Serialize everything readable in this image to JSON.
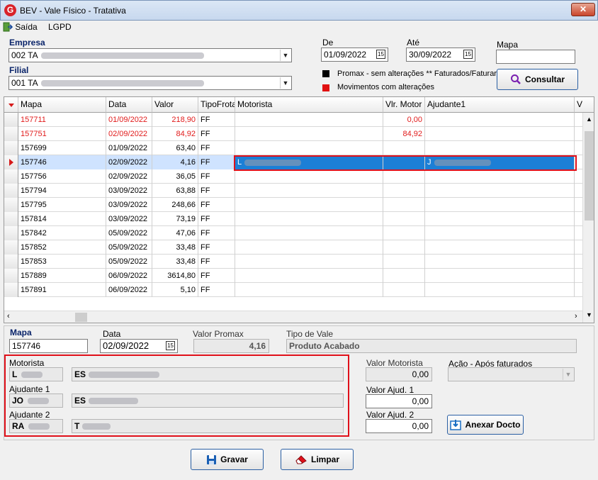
{
  "window": {
    "title": "BEV - Vale Físico - Tratativa",
    "app_icon": "G",
    "close_icon": "✕"
  },
  "menu": {
    "saida": "Saída",
    "lgpd": "LGPD"
  },
  "filters": {
    "empresa_label": "Empresa",
    "empresa_value": "002 TA",
    "filial_label": "Filial",
    "filial_value": "001 TA",
    "de_label": "De",
    "de_value": "01/09/2022",
    "ate_label": "Até",
    "ate_value": "30/09/2022",
    "mapa_label": "Mapa",
    "mapa_value": "",
    "calendar_glyph": "15"
  },
  "legend": [
    {
      "text": "Promax - sem alterações ** Faturados/Faturar",
      "color": "#000000"
    },
    {
      "text": "Movimentos com alterações",
      "color": "#e01010"
    }
  ],
  "consultar_label": "Consultar",
  "grid": {
    "headers": [
      "Mapa",
      "Data",
      "Valor",
      "TipoFrota",
      "Motorista",
      "Vlr. Motor",
      "Ajudante1",
      "V"
    ],
    "rows": [
      {
        "mapa": "157711",
        "data": "01/09/2022",
        "valor": "218,90",
        "tipo": "FF",
        "motorista": "",
        "vlr_motor": "0,00",
        "ajudante1": "",
        "red": true
      },
      {
        "mapa": "157751",
        "data": "02/09/2022",
        "valor": "84,92",
        "tipo": "FF",
        "motorista": "",
        "vlr_motor": "84,92",
        "ajudante1": "",
        "red": true
      },
      {
        "mapa": "157699",
        "data": "01/09/2022",
        "valor": "63,40",
        "tipo": "FF",
        "motorista": "",
        "vlr_motor": "",
        "ajudante1": ""
      },
      {
        "mapa": "157746",
        "data": "02/09/2022",
        "valor": "4,16",
        "tipo": "FF",
        "motorista": "L",
        "vlr_motor": "",
        "ajudante1": "J",
        "selected": true
      },
      {
        "mapa": "157756",
        "data": "02/09/2022",
        "valor": "36,05",
        "tipo": "FF",
        "motorista": "",
        "vlr_motor": "",
        "ajudante1": ""
      },
      {
        "mapa": "157794",
        "data": "03/09/2022",
        "valor": "63,88",
        "tipo": "FF",
        "motorista": "",
        "vlr_motor": "",
        "ajudante1": ""
      },
      {
        "mapa": "157795",
        "data": "03/09/2022",
        "valor": "248,66",
        "tipo": "FF",
        "motorista": "",
        "vlr_motor": "",
        "ajudante1": ""
      },
      {
        "mapa": "157814",
        "data": "03/09/2022",
        "valor": "73,19",
        "tipo": "FF",
        "motorista": "",
        "vlr_motor": "",
        "ajudante1": ""
      },
      {
        "mapa": "157842",
        "data": "05/09/2022",
        "valor": "47,06",
        "tipo": "FF",
        "motorista": "",
        "vlr_motor": "",
        "ajudante1": ""
      },
      {
        "mapa": "157852",
        "data": "05/09/2022",
        "valor": "33,48",
        "tipo": "FF",
        "motorista": "",
        "vlr_motor": "",
        "ajudante1": ""
      },
      {
        "mapa": "157853",
        "data": "05/09/2022",
        "valor": "33,48",
        "tipo": "FF",
        "motorista": "",
        "vlr_motor": "",
        "ajudante1": ""
      },
      {
        "mapa": "157889",
        "data": "06/09/2022",
        "valor": "3614,80",
        "tipo": "FF",
        "motorista": "",
        "vlr_motor": "",
        "ajudante1": ""
      },
      {
        "mapa": "157891",
        "data": "06/09/2022",
        "valor": "5,10",
        "tipo": "FF",
        "motorista": "",
        "vlr_motor": "",
        "ajudante1": ""
      }
    ]
  },
  "detail": {
    "mapa_label": "Mapa",
    "mapa_value": "157746",
    "data_label": "Data",
    "data_value": "02/09/2022",
    "valor_promax_label": "Valor Promax",
    "valor_promax_value": "4,16",
    "tipo_vale_label": "Tipo de Vale",
    "tipo_vale_value": "Produto Acabado",
    "motorista_label": "Motorista",
    "motorista_code": "L",
    "motorista_name": "ES",
    "ajudante1_label": "Ajudante 1",
    "ajudante1_code": "JO",
    "ajudante1_name": "ES",
    "ajudante2_label": "Ajudante 2",
    "ajudante2_code": "RA",
    "ajudante2_name": "T",
    "valor_motorista_label": "Valor Motorista",
    "valor_motorista_value": "0,00",
    "valor_ajud1_label": "Valor Ajud. 1",
    "valor_ajud1_value": "0,00",
    "valor_ajud2_label": "Valor Ajud. 2",
    "valor_ajud2_value": "0,00",
    "acao_label": "Ação - Após faturados",
    "acao_value": "",
    "anexar_label": "Anexar Docto"
  },
  "footer": {
    "gravar": "Gravar",
    "limpar": "Limpar"
  }
}
